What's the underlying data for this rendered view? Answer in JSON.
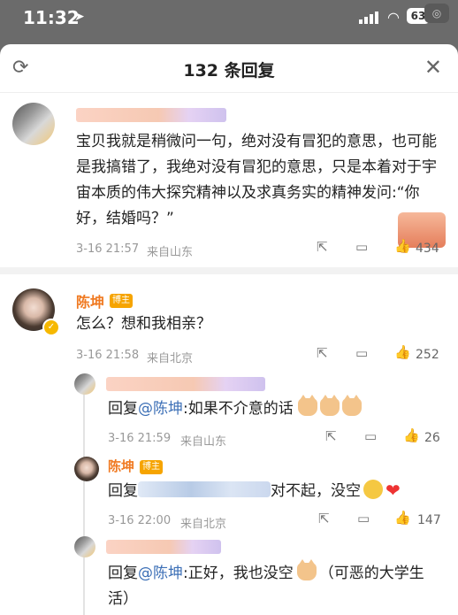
{
  "status_bar": {
    "time": "11:32",
    "battery": "63"
  },
  "header": {
    "title": "132 条回复"
  },
  "comments": [
    {
      "text": "宝贝我就是稍微问一句，绝对没有冒犯的意思，也可能是我搞错了，我绝对没有冒犯的意思，只是本着对于宇宙本质的伟大探究精神以及求真务实的精神发问:“你好，结婚吗？”",
      "time": "3-16 21:57",
      "location": "来自山东",
      "likes": "434"
    },
    {
      "author": "陈坤",
      "badge": "博主",
      "text": "怎么？想和我相亲？",
      "time": "3-16 21:58",
      "location": "来自北京",
      "likes": "252"
    }
  ],
  "replies": [
    {
      "reply_prefix": "回复",
      "mention": "@陈坤",
      "text": ":如果不介意的话",
      "time": "3-16 21:59",
      "location": "来自山东",
      "likes": "26"
    },
    {
      "author": "陈坤",
      "badge": "博主",
      "reply_prefix": "回复",
      "text": "对不起，没空",
      "time": "3-16 22:00",
      "location": "来自北京",
      "likes": "147"
    },
    {
      "reply_prefix": "回复",
      "mention": "@陈坤",
      "text": ":正好，我也没空",
      "text_tail": "（可恶的大学生活）"
    }
  ],
  "colors": {
    "accent": "#f07a22",
    "mention": "#3c6fb6",
    "overlay": "#6b6b6b"
  }
}
